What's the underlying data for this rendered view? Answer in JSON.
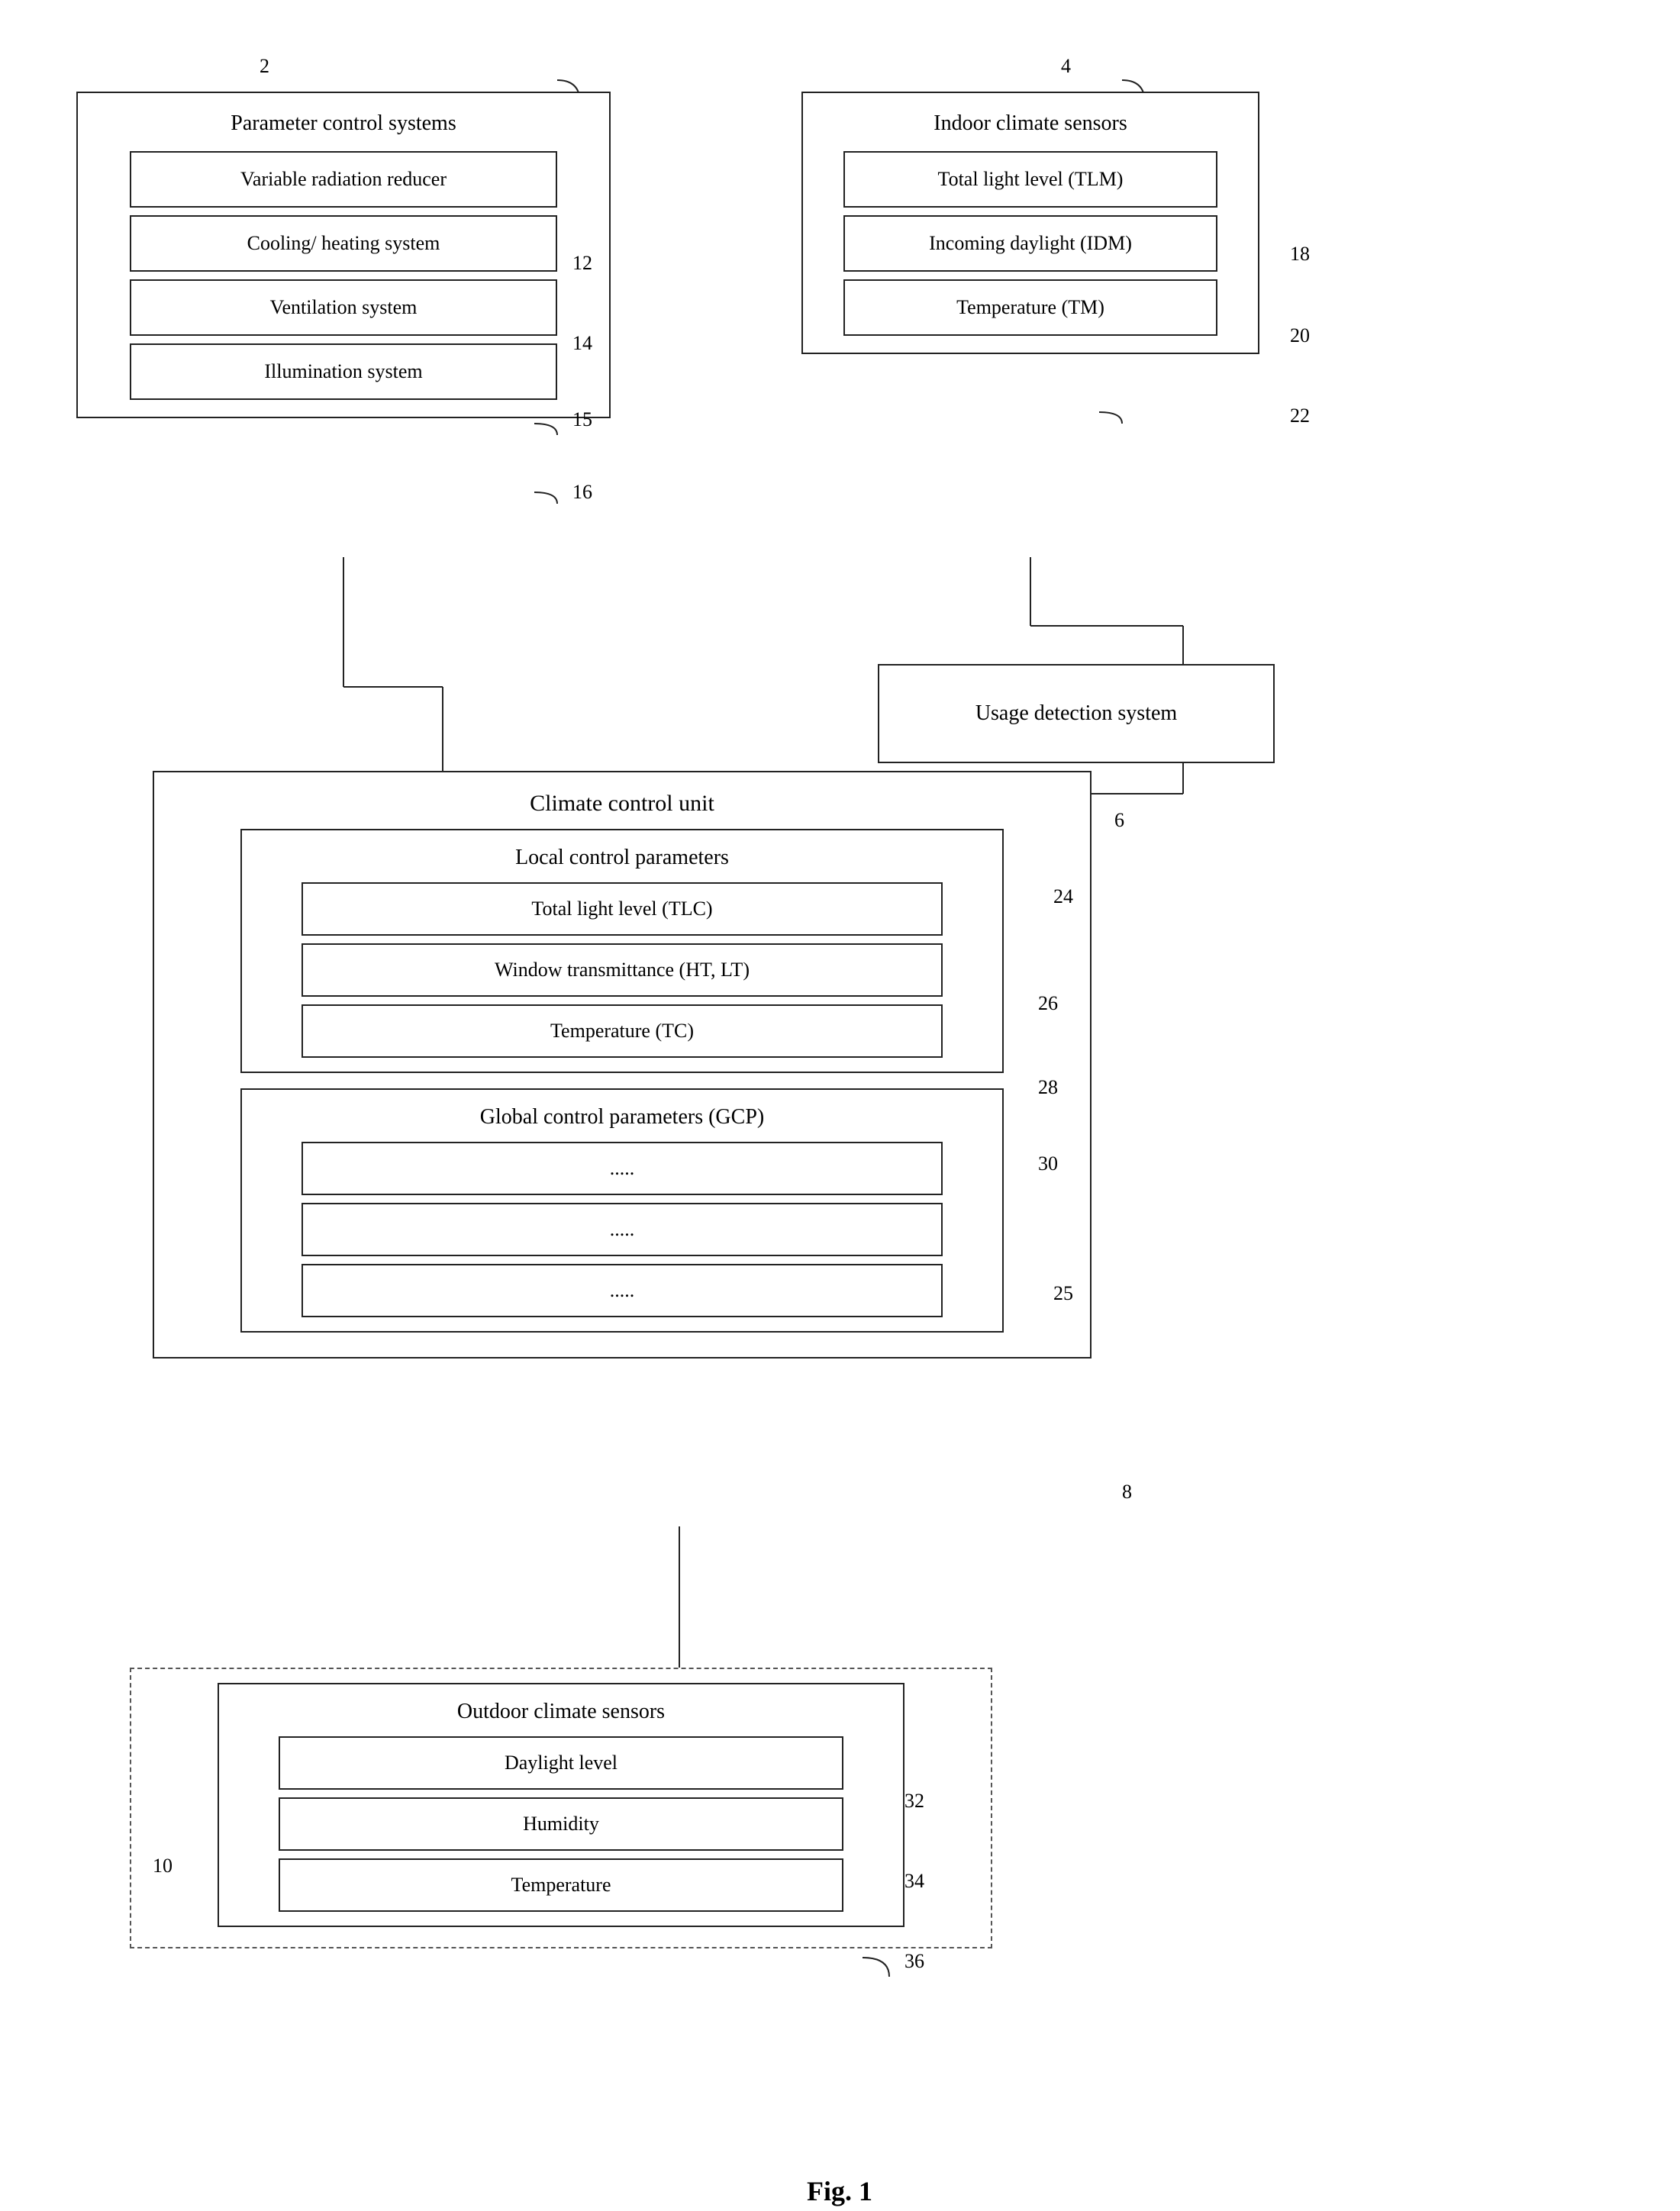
{
  "diagram": {
    "title": "Fig. 1",
    "boxes": {
      "param_control": {
        "label": "Parameter control systems",
        "ref": "2",
        "items": [
          {
            "label": "Variable radiation reducer",
            "ref": "12"
          },
          {
            "label": "Cooling/ heating system",
            "ref": "14"
          },
          {
            "label": "Ventilation system",
            "ref": "15"
          },
          {
            "label": "Illumination system",
            "ref": "16"
          }
        ]
      },
      "indoor_sensors": {
        "label": "Indoor climate sensors",
        "ref": "4",
        "items": [
          {
            "label": "Total light level (TLM)",
            "ref": "18"
          },
          {
            "label": "Incoming daylight (IDM)",
            "ref": "20"
          },
          {
            "label": "Temperature (TM)",
            "ref": "22"
          }
        ]
      },
      "usage_detection": {
        "label": "Usage detection system"
      },
      "climate_control": {
        "label": "Climate control unit",
        "ref": "6",
        "local_params": {
          "label": "Local control parameters",
          "ref": "24",
          "items": [
            {
              "label": "Total light level (TLC)",
              "ref": "26"
            },
            {
              "label": "Window transmittance (HT, LT)",
              "ref": "28"
            },
            {
              "label": "Temperature (TC)",
              "ref": "30"
            }
          ]
        },
        "global_params": {
          "label": "Global control parameters (GCP)",
          "ref": "25",
          "items": [
            {
              "label": ".....",
              "ref": ""
            },
            {
              "label": ".....",
              "ref": ""
            },
            {
              "label": ".....",
              "ref": ""
            }
          ]
        },
        "ref_8": "8"
      },
      "outdoor_sensors": {
        "label": "Outdoor climate sensors",
        "ref": "10",
        "items": [
          {
            "label": "Daylight level",
            "ref": "32"
          },
          {
            "label": "Humidity",
            "ref": "34"
          },
          {
            "label": "Temperature",
            "ref": "36"
          }
        ]
      }
    }
  }
}
